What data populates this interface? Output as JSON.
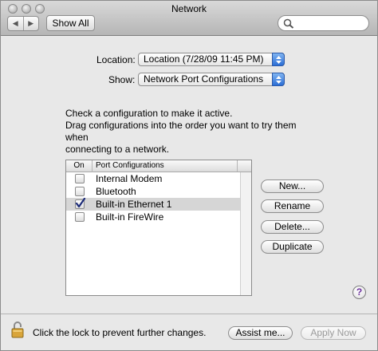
{
  "window": {
    "title": "Network"
  },
  "toolbar": {
    "back_label": "◀",
    "forward_label": "▶",
    "show_all_label": "Show All",
    "search_placeholder": ""
  },
  "location": {
    "label": "Location:",
    "value": "Location (7/28/09 11:45 PM)"
  },
  "show": {
    "label": "Show:",
    "value": "Network Port Configurations"
  },
  "instructions": {
    "line1": "Check a configuration to make it active.",
    "line2": "Drag configurations into the order you want to try them when",
    "line3": "connecting to a network."
  },
  "table": {
    "columns": {
      "on": "On",
      "name": "Port Configurations"
    },
    "rows": [
      {
        "name": "Internal Modem",
        "checked": false,
        "selected": false
      },
      {
        "name": "Bluetooth",
        "checked": false,
        "selected": false
      },
      {
        "name": "Built-in Ethernet 1",
        "checked": true,
        "selected": true
      },
      {
        "name": "Built-in FireWire",
        "checked": false,
        "selected": false
      }
    ]
  },
  "buttons": {
    "new": "New...",
    "rename": "Rename",
    "delete": "Delete...",
    "duplicate": "Duplicate",
    "help": "?",
    "assist": "Assist me...",
    "apply": "Apply Now"
  },
  "footer": {
    "lock_message": "Click the lock to prevent further changes."
  },
  "colors": {
    "selected_row": "#d6d6d6",
    "popup_accent": "#2c6ed5",
    "help_mark": "#6a2d9c"
  },
  "icons": [
    "traffic-light-close",
    "traffic-light-minimize",
    "traffic-light-zoom",
    "search-icon",
    "popup-arrows-icon",
    "checkmark-icon",
    "help-icon",
    "lock-icon"
  ]
}
